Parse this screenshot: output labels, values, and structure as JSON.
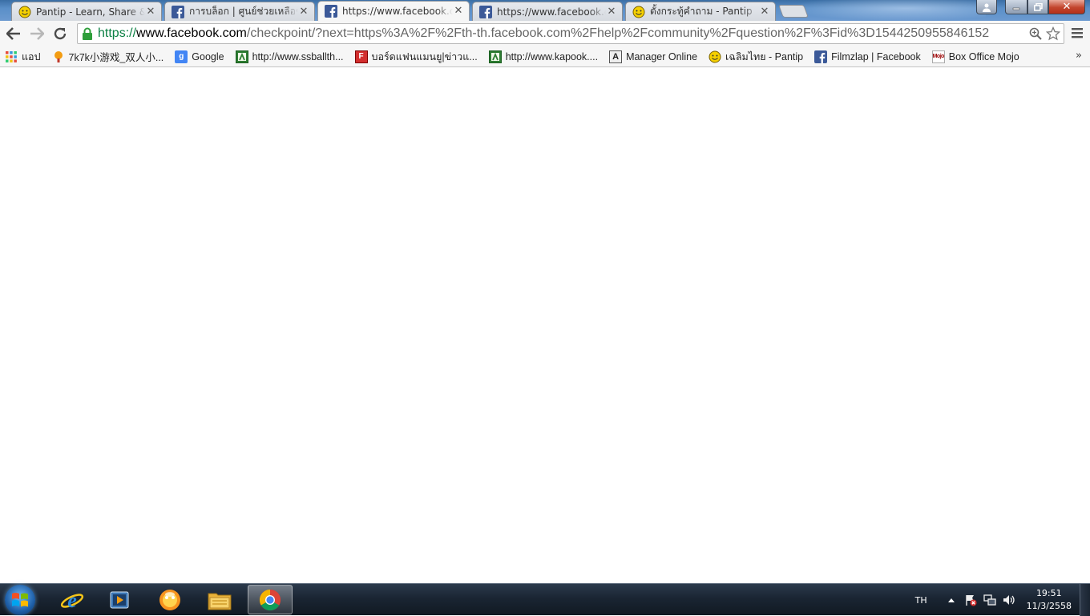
{
  "tabs": [
    {
      "title": "Pantip - Learn, Share & Fun",
      "icon": "pantip-smiley-icon",
      "active": false
    },
    {
      "title": "การบล็อก | ศูนย์ช่วยเหลือของ Facebook",
      "icon": "facebook-icon",
      "active": false
    },
    {
      "title": "https://www.facebook.com/checkpoint",
      "icon": "facebook-icon",
      "active": true
    },
    {
      "title": "https://www.facebook.com/checkpoint",
      "icon": "facebook-icon",
      "active": false
    },
    {
      "title": "ตั้งกระทู้คำถาม - Pantip",
      "icon": "pantip-smiley-icon",
      "active": false
    }
  ],
  "omnibox": {
    "scheme": "https://",
    "host": "www.facebook.com",
    "path": "/checkpoint/?next=https%3A%2F%2Fth-th.facebook.com%2Fhelp%2Fcommunity%2Fquestion%2F%3Fid%3D1544250955846152"
  },
  "bookmarks": [
    {
      "label": "แอป",
      "icon": "apps-grid-icon"
    },
    {
      "label": "7k7k小游戏_双人小...",
      "icon": "7k7k-icon"
    },
    {
      "label": "Google",
      "icon": "google-icon"
    },
    {
      "label": "http://www.ssballth...",
      "icon": "ssball-icon"
    },
    {
      "label": "บอร์ดแฟนแมนยู|ข่าวแ...",
      "icon": "board-icon"
    },
    {
      "label": "http://www.kapook....",
      "icon": "kapook-icon"
    },
    {
      "label": "Manager Online",
      "icon": "manager-online-icon"
    },
    {
      "label": "เฉลิมไทย - Pantip",
      "icon": "pantip-smiley-icon"
    },
    {
      "label": "Filmzlap | Facebook",
      "icon": "facebook-icon"
    },
    {
      "label": "Box Office Mojo",
      "icon": "mojo-icon"
    }
  ],
  "bookmarks_overflow": "»",
  "taskbar": {
    "apps": [
      "internet-explorer-icon",
      "media-player-icon",
      "messenger-icon",
      "file-explorer-icon",
      "chrome-icon"
    ],
    "language": "TH",
    "time": "19:51",
    "date": "11/3/2558"
  }
}
